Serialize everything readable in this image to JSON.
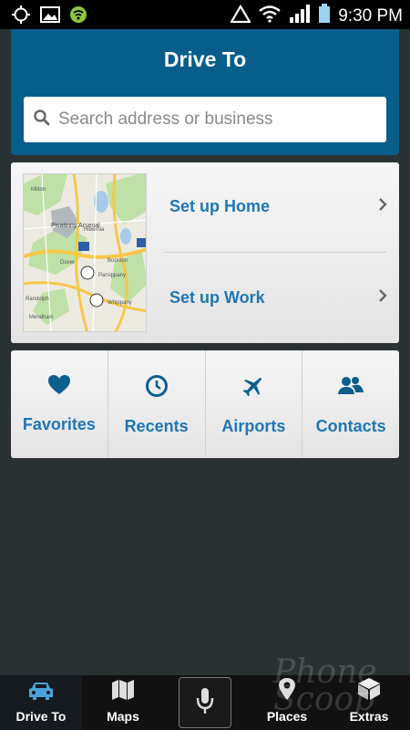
{
  "status_bar": {
    "time": "9:30 PM",
    "icons": [
      "gps-icon",
      "image-icon",
      "wifi-badge-icon",
      "triangle-alert-icon",
      "wifi-icon",
      "signal-icon",
      "battery-icon"
    ]
  },
  "header": {
    "title": "Drive To",
    "search_placeholder": "Search address or business"
  },
  "setup": {
    "map_labels": [
      "Picatinny Arsenal",
      "Boonton",
      "Dover",
      "Parsippany",
      "Randolph",
      "Whippany",
      "Mendham",
      "Milton",
      "Hibernia"
    ],
    "home_label": "Set up Home",
    "work_label": "Set up Work"
  },
  "categories": [
    {
      "label": "Favorites",
      "icon": "heart-icon"
    },
    {
      "label": "Recents",
      "icon": "clock-icon"
    },
    {
      "label": "Airports",
      "icon": "airplane-icon"
    },
    {
      "label": "Contacts",
      "icon": "contacts-icon"
    }
  ],
  "nav": {
    "items": [
      {
        "label": "Drive To",
        "icon": "car-icon"
      },
      {
        "label": "Maps",
        "icon": "map-icon"
      },
      {
        "label": "",
        "icon": "microphone-icon"
      },
      {
        "label": "Places",
        "icon": "pin-icon"
      },
      {
        "label": "Extras",
        "icon": "box-icon"
      }
    ]
  },
  "colors": {
    "header_blue": "#075e8a",
    "accent_blue": "#1f77b4",
    "background": "#2a3133"
  }
}
